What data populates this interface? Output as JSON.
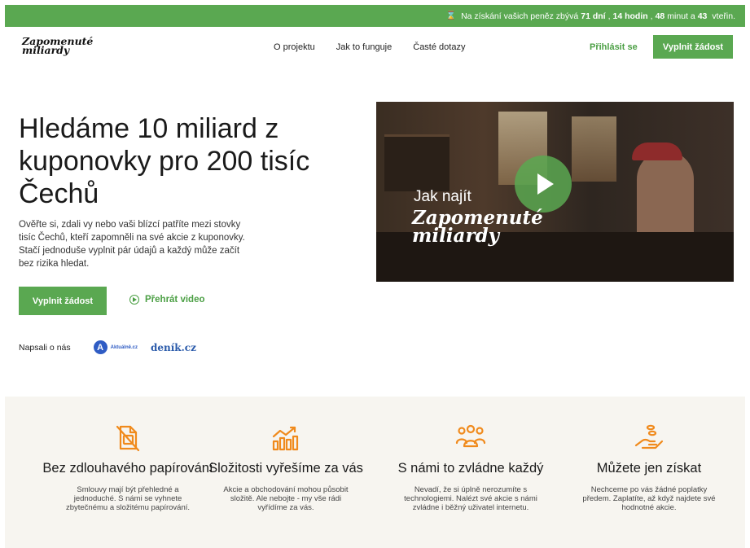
{
  "topbar": {
    "hourglass_icon": "hourglass-icon",
    "prefix": "Na získání vašich peněz zbývá",
    "days": "71 dní",
    "sep1": ",",
    "hours": "14 hodin",
    "sep2": ",",
    "minutes": "48",
    "minutes_unit": "minut a",
    "seconds": "43",
    "seconds_unit": "vteřin."
  },
  "header": {
    "logo_line1": "Zapomenuté",
    "logo_line2": "miliardy",
    "nav": [
      "O projektu",
      "Jak to funguje",
      "Časté dotazy"
    ],
    "login": "Přihlásit se",
    "cta": "Vyplnit žádost"
  },
  "hero": {
    "title": "Hledáme 10 miliard z kuponovky pro 200 tisíc Čechů",
    "text": "Ověřte si, zdali vy nebo vaši blízcí patříte mezi stovky tisíc Čechů, kteří zapomněli na své akcie z kuponovky. Stačí jednoduše vyplnit pár údajů a každý může začít bez rizika hledat.",
    "cta": "Vyplnit žádost",
    "play_link": "Přehrát video"
  },
  "press": {
    "label": "Napsali o nás",
    "aktualne_badge": "A",
    "aktualne_text": "Aktuálně.cz",
    "denik": "deník.cz"
  },
  "video": {
    "line1": "Jak najít",
    "line2": "Zapomenuté",
    "line3": "miliardy"
  },
  "features": [
    {
      "icon": "document-off-icon",
      "title": "Bez zdlouhavého papírování",
      "text": "Smlouvy mají být přehledné a jednoduché. S námi se vyhnete zbytečnému a složitému papírování."
    },
    {
      "icon": "chart-growth-icon",
      "title": "Složitosti vyřešíme za vás",
      "text": "Akcie a obchodování mohou působit složitě. Ale nebojte - my vše rádi vyřídíme za vás."
    },
    {
      "icon": "people-group-icon",
      "title": "S námi to zvládne každý",
      "text": "Nevadí, že si úplně nerozumíte s technologiemi. Nalézt své akcie s námi zvládne i běžný uživatel internetu."
    },
    {
      "icon": "hand-coins-icon",
      "title": "Můžete jen získat",
      "text": "Nechceme po vás žádné poplatky předem. Zaplatíte, až když najdete své hodnotné akcie."
    }
  ],
  "colors": {
    "accent": "#5aa851",
    "icon_orange": "#f08a1c",
    "features_bg": "#f7f5f0"
  }
}
